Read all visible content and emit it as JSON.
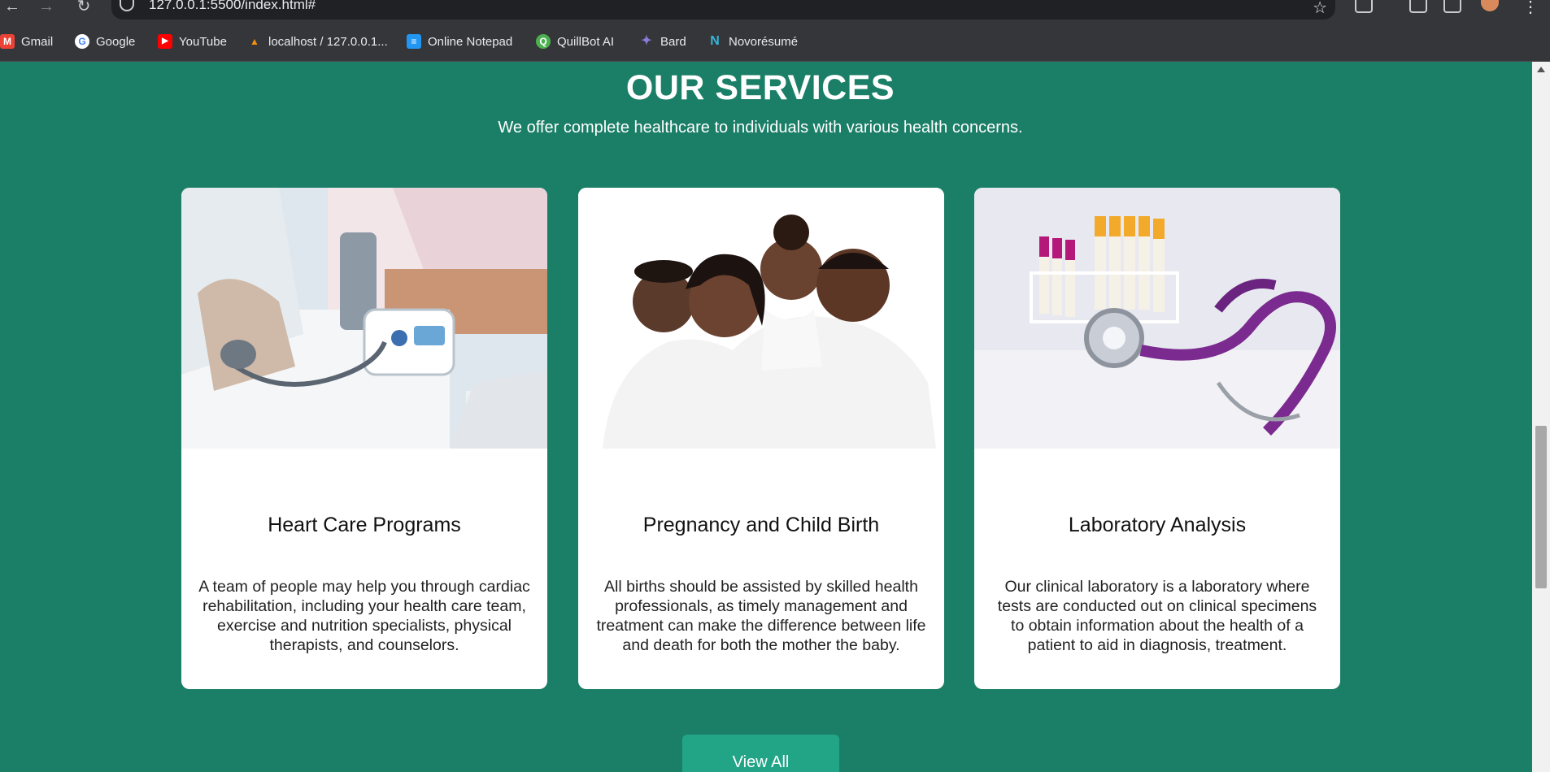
{
  "browser": {
    "url": "127.0.0.1:5500/index.html#",
    "bookmarks": [
      "Gmail",
      "Google",
      "YouTube",
      "localhost / 127.0.0.1...",
      "Online Notepad",
      "QuillBot AI",
      "Bard",
      "Novorésumé"
    ]
  },
  "section": {
    "title": "OUR SERVICES",
    "subtitle": "We offer complete healthcare to individuals with various health concerns."
  },
  "cards": [
    {
      "title": "Heart Care Programs",
      "text": "A team of people may help you through cardiac rehabilitation, including your health care team, exercise and nutrition specialists, physical therapists, and counselors."
    },
    {
      "title": "Pregnancy and Child Birth",
      "text": "All births should be assisted by skilled health professionals, as timely management and treatment can make the difference between life and death for both the mother the baby."
    },
    {
      "title": "Laboratory Analysis",
      "text": "Our clinical laboratory is a laboratory where tests are conducted out on clinical specimens to obtain information about the health of a patient to aid in diagnosis, treatment."
    }
  ],
  "button": {
    "label": "View All"
  },
  "colors": {
    "background": "#1b7f68",
    "button": "#22a587",
    "card": "#ffffff"
  }
}
